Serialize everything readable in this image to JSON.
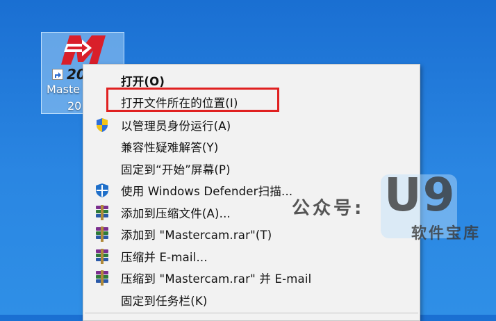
{
  "desktop": {
    "icon": {
      "version_badge": "20",
      "label_line1": "Maste",
      "label_line2": "20"
    }
  },
  "context_menu": {
    "items": [
      {
        "label": "打开(O)",
        "icon": "none",
        "bold": true
      },
      {
        "label": "打开文件所在的位置(I)",
        "icon": "none"
      },
      {
        "label": "以管理员身份运行(A)",
        "icon": "uac-shield-icon"
      },
      {
        "label": "兼容性疑难解答(Y)",
        "icon": "none"
      },
      {
        "label": "固定到“开始”屏幕(P)",
        "icon": "none"
      },
      {
        "label": "使用 Windows Defender扫描...",
        "icon": "windows-defender-icon"
      },
      {
        "label": "添加到压缩文件(A)...",
        "icon": "winrar-icon"
      },
      {
        "label": "添加到 \"Mastercam.rar\"(T)",
        "icon": "winrar-icon"
      },
      {
        "label": "压缩并 E-mail...",
        "icon": "winrar-icon"
      },
      {
        "label": "压缩到 \"Mastercam.rar\" 并 E-mail",
        "icon": "winrar-icon"
      },
      {
        "label": "固定到任务栏(K)",
        "icon": "none"
      }
    ],
    "highlight_color": "#e02020"
  },
  "watermark": {
    "prefix": "公众号:",
    "logo": "U9",
    "subtitle": "软件宝库"
  }
}
